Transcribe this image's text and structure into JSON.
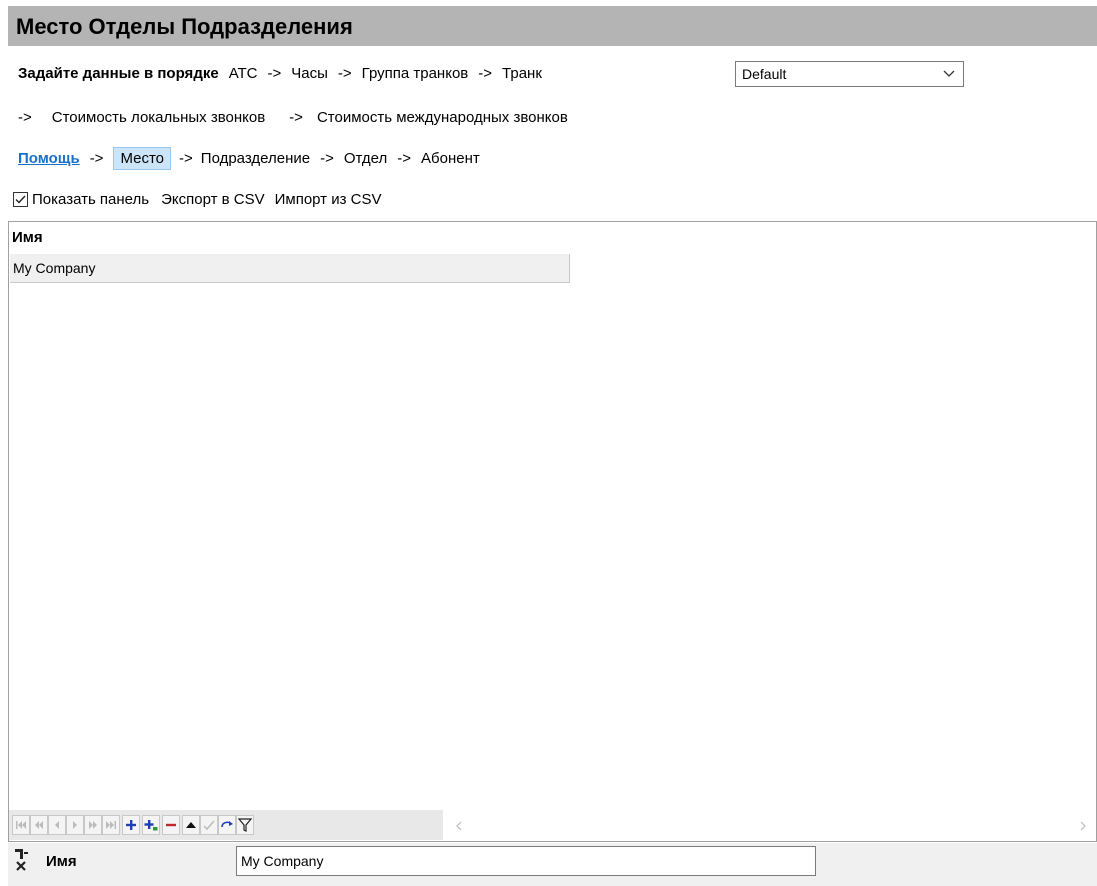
{
  "title": "Место Отделы Подразделения",
  "order_row": {
    "intro": "Задайте данные в порядке",
    "items": [
      "АТС",
      "Часы",
      "Группа транков",
      "Транк"
    ],
    "arrow": "->"
  },
  "combo": {
    "value": "Default",
    "icon": "chevron-down-icon"
  },
  "cost_row": {
    "arrow": "->",
    "local": "Стоимость локальных звонков",
    "international": "Стоимость международных звонков"
  },
  "nav_row": {
    "help": "Помощь",
    "arrow": "->",
    "items": [
      "Место",
      "Подразделение",
      "Отдел",
      "Абонент"
    ],
    "selected_index": 0
  },
  "options": {
    "show_panel": "Показать панель",
    "show_panel_checked": true,
    "export_csv": "Экспорт в CSV",
    "import_csv": "Импорт из CSV"
  },
  "grid": {
    "columns": [
      "Имя"
    ],
    "rows": [
      [
        "My Company"
      ]
    ]
  },
  "navigator": {
    "buttons": [
      "first-icon",
      "prev-page-icon",
      "prev-icon",
      "next-icon",
      "next-page-icon",
      "last-icon",
      "insert-icon",
      "append-icon",
      "delete-icon",
      "edit-icon",
      "post-icon",
      "cancel-icon",
      "filter-icon"
    ]
  },
  "editor": {
    "label": "Имя",
    "value": "My Company",
    "icon": "clear-filter-icon"
  },
  "colors": {
    "title_bg": "#b4b4b4",
    "link": "#1a6fc9",
    "selected_bg": "#cce4f7",
    "add_blue": "#1f3fb8",
    "delete_red": "#c0282d"
  }
}
